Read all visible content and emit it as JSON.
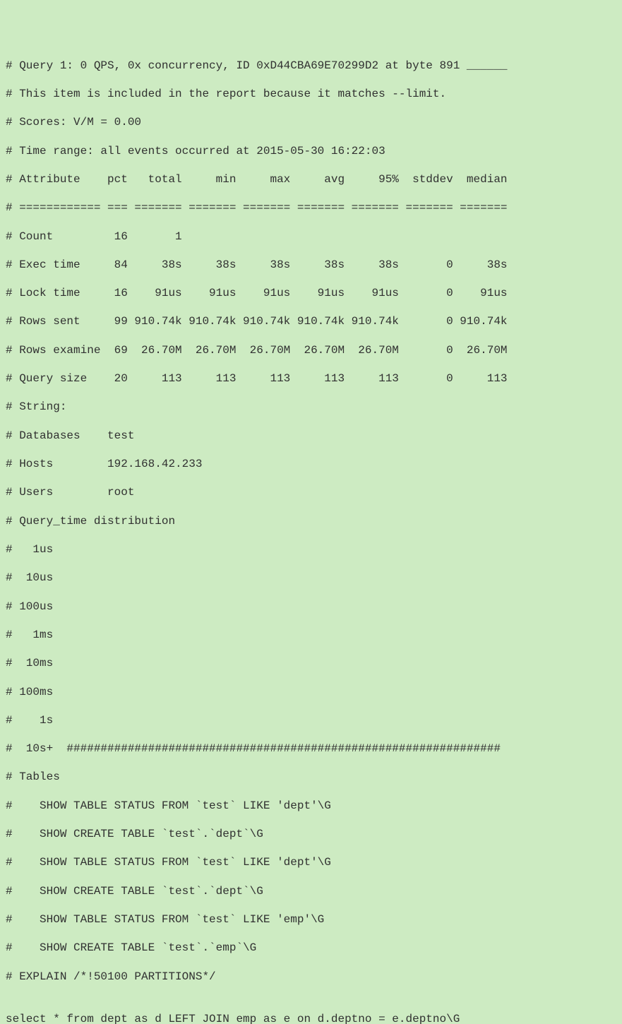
{
  "header": {
    "line1": "# Query 1: 0 QPS, 0x concurrency, ID 0xD44CBA69E70299D2 at byte 891 ______",
    "line2": "# This item is included in the report because it matches --limit.",
    "line3": "# Scores: V/M = 0.00",
    "line4": "# Time range: all events occurred at 2015-05-30 16:22:03"
  },
  "table": {
    "header": "# Attribute    pct   total     min     max     avg     95%  stddev  median",
    "divider": "# ============ === ======= ======= ======= ======= ======= ======= =======",
    "rows": [
      "# Count         16       1",
      "# Exec time     84     38s     38s     38s     38s     38s       0     38s",
      "# Lock time     16    91us    91us    91us    91us    91us       0    91us",
      "# Rows sent     99 910.74k 910.74k 910.74k 910.74k 910.74k       0 910.74k",
      "# Rows examine  69  26.70M  26.70M  26.70M  26.70M  26.70M       0  26.70M",
      "# Query size    20     113     113     113     113     113       0     113"
    ]
  },
  "strings": {
    "header": "# String:",
    "databases": "# Databases    test",
    "hosts": "# Hosts        192.168.42.233",
    "users": "# Users        root"
  },
  "distribution": {
    "header": "# Query_time distribution",
    "buckets": [
      "#   1us",
      "#  10us",
      "# 100us",
      "#   1ms",
      "#  10ms",
      "# 100ms",
      "#    1s",
      "#  10s+  ################################################################"
    ]
  },
  "tables": {
    "header": "# Tables",
    "commands": [
      "#    SHOW TABLE STATUS FROM `test` LIKE 'dept'\\G",
      "#    SHOW CREATE TABLE `test`.`dept`\\G",
      "#    SHOW TABLE STATUS FROM `test` LIKE 'dept'\\G",
      "#    SHOW CREATE TABLE `test`.`dept`\\G",
      "#    SHOW TABLE STATUS FROM `test` LIKE 'emp'\\G",
      "#    SHOW CREATE TABLE `test`.`emp`\\G"
    ]
  },
  "explain": "# EXPLAIN /*!50100 PARTITIONS*/",
  "blank": "",
  "query": "select * from dept as d LEFT JOIN emp as e on d.deptno = e.deptno\\G"
}
